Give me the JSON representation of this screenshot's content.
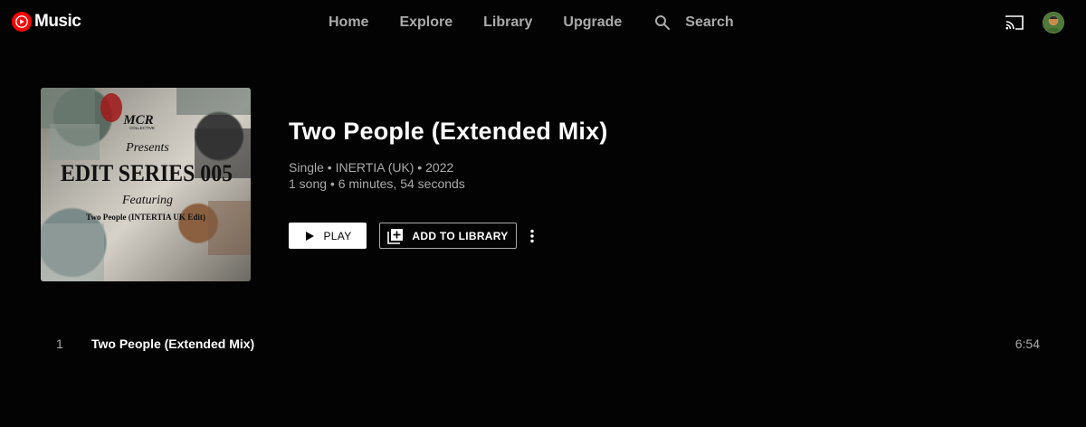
{
  "app": {
    "logo_text": "Music",
    "accent_color": "#ff0000"
  },
  "nav": {
    "items": [
      {
        "label": "Home"
      },
      {
        "label": "Explore"
      },
      {
        "label": "Library"
      },
      {
        "label": "Upgrade"
      }
    ],
    "search_label": "Search"
  },
  "header_icons": {
    "cast": "cast-icon",
    "account": "avatar"
  },
  "album": {
    "art_text": {
      "logo": "MCR",
      "logo_sub": "COLLECTIVE",
      "presents": "Presents",
      "series": "EDIT SERIES 005",
      "featuring": "Featuring",
      "track": "Two People (INTERTIA UK Edit)"
    },
    "title": "Two People (Extended Mix)",
    "subtitle": "Single • INERTIA (UK) • 2022",
    "meta": "1 song • 6 minutes, 54 seconds"
  },
  "actions": {
    "play_label": "PLAY",
    "add_label": "ADD TO LIBRARY",
    "more_icon": "more-vert-icon"
  },
  "tracks": [
    {
      "number": "1",
      "title": "Two People (Extended Mix)",
      "duration": "6:54"
    }
  ]
}
